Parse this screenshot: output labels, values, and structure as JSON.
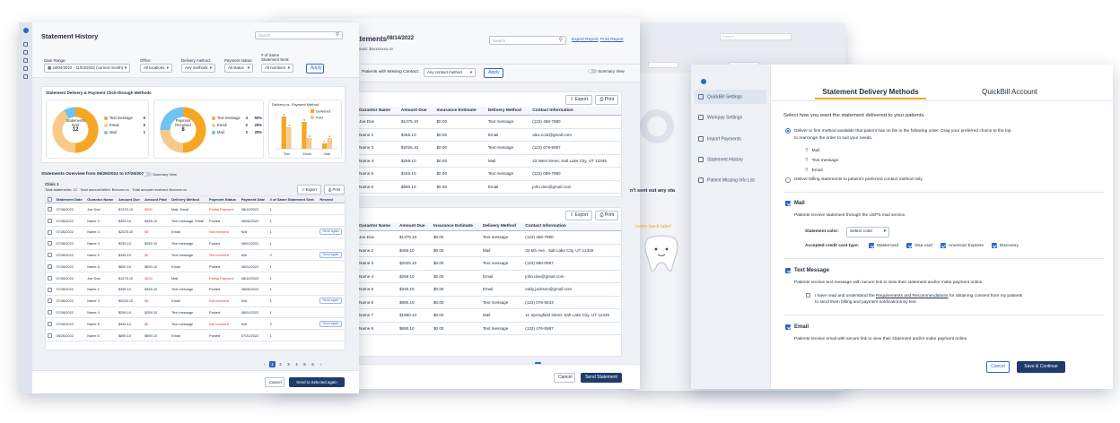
{
  "ghost": {
    "search": "Search",
    "select_a": "",
    "select_b": ""
  },
  "card1": {
    "title": "Statement History",
    "search_placeholder": "Search",
    "filters": {
      "date_range_label": "Date Range:",
      "date_range_value": "10/04/2022 - 11/04/2022 (current month)",
      "office_label": "Office:",
      "office_value": "All locations",
      "delivery_label": "Delivery method:",
      "delivery_value": "Any methods",
      "status_label": "Payment status:",
      "status_value": "All status",
      "sent_label_1": "# of Same",
      "sent_label_2": "Statement Sent:",
      "sent_value": "All numbers",
      "apply": "Apply"
    },
    "chart_section_title": "Statement Delivery & Payment Click-through Methods",
    "donut1": {
      "center_top": "Statements",
      "center_mid": "Sent",
      "center_num": "12",
      "legend": [
        {
          "label": "Text message",
          "value": "6",
          "color": "#f5a623"
        },
        {
          "label": "Email",
          "value": "5",
          "color": "#f8c98a"
        },
        {
          "label": "Mail",
          "value": "1",
          "color": "#6fc3f0"
        }
      ]
    },
    "donut2": {
      "center_top": "Payment",
      "center_mid": "Received",
      "center_num": "8",
      "legend": [
        {
          "label": "Text message",
          "value": "4",
          "pct": "50%",
          "color": "#f5a623"
        },
        {
          "label": "Email",
          "value": "2",
          "pct": "25%",
          "color": "#f8c98a"
        },
        {
          "label": "Mail",
          "value": "2",
          "pct": "25%",
          "color": "#6fc3f0"
        }
      ]
    },
    "chart_data": {
      "type": "bar",
      "title": "Delivery vs. Payment Method",
      "categories": [
        "Text",
        "Email",
        "Mail"
      ],
      "series": [
        {
          "name": "Delivered",
          "values": [
            6,
            5,
            1
          ],
          "color": "#f5a623"
        },
        {
          "name": "Paid",
          "values": [
            4,
            2,
            2
          ],
          "color": "#f8c98a"
        }
      ],
      "ylim": [
        0,
        7
      ]
    },
    "overview_title": "Statements Overview from 06/26/2022 to 07/26/2022",
    "summary_view": "Summary View",
    "clinic": "Clinic 1",
    "totals": {
      "statements": "Total statements: 12",
      "billed": "Total amount billed: $xxxxxx.xx",
      "received": "Total amount received: $xxxxxx.xx"
    },
    "export": "Export",
    "print": "Print",
    "headers": [
      "Statement Date",
      "Gurantor Name",
      "Amount Due",
      "Amount Paid",
      "Delivery Method",
      "Payment Status",
      "Payment Date",
      "# of Same Statement Sent",
      "Resend"
    ],
    "rows": [
      [
        "07/26/2022",
        "Joe Doe",
        "$1375.10",
        "$200",
        "Mail, Email",
        "Partial Payment",
        "08/10/2022",
        "1",
        ""
      ],
      [
        "07/26/2022",
        "Name 2",
        "$455.10",
        "$455.10",
        "Text message, Email",
        "Posted",
        "08/06/2022",
        "1",
        ""
      ],
      [
        "07/26/2022",
        "Name 3",
        "$2025.10",
        "$0",
        "Email",
        "Not received",
        "N/A",
        "1",
        "Send again"
      ],
      [
        "07/26/2022",
        "Name 4",
        "$259.10",
        "$259.10",
        "Text message",
        "Posted",
        "08/01/2022",
        "1",
        ""
      ],
      [
        "07/26/2022",
        "Name 5",
        "$345.10",
        "$0",
        "Text message",
        "Not received",
        "N/A",
        "2",
        "Send again"
      ],
      [
        "07/26/2022",
        "Name 6",
        "$890.10",
        "$890.10",
        "Email",
        "Posted",
        "08/01/2022",
        "1",
        ""
      ],
      [
        "07/26/2022",
        "Joe Doe",
        "$1375.10",
        "$200",
        "Mail",
        "Partial Payment",
        "08/10/2022",
        "1",
        ""
      ],
      [
        "07/26/2022",
        "Name 2",
        "$455.10",
        "$455.10",
        "Text message",
        "Posted",
        "08/06/2022",
        "1",
        ""
      ],
      [
        "07/26/2022",
        "Name 3",
        "$2025.10",
        "$0",
        "Email",
        "Not received",
        "N/A",
        "1",
        "Send again"
      ],
      [
        "07/26/2022",
        "Name 4",
        "$259.10",
        "$259.10",
        "Text message",
        "Posted",
        "08/01/2022",
        "1",
        ""
      ],
      [
        "07/26/2022",
        "Name 5",
        "$345.10",
        "$0",
        "Text message",
        "Not received",
        "N/A",
        "2",
        "Send again"
      ],
      [
        "06/26/2022",
        "Name 6",
        "$890.10",
        "$890.10",
        "Email",
        "Posted",
        "07/21/2022",
        "1",
        ""
      ]
    ],
    "pages": [
      "1",
      "2",
      "3",
      "4",
      "5",
      "6"
    ],
    "cancel": "Cancel",
    "send_selected": "Send to Selected again"
  },
  "card2": {
    "title": "atements",
    "date": "08/14/2022",
    "subtitle": "mount: $xxxxxxxx.xx",
    "search_placeholder": "Search",
    "export_report": "Export Report",
    "print_report": "Print Report",
    "missing_label": "Patients with Missing Contact:",
    "missing_value": "Any contact method",
    "apply": "Apply",
    "summary_view": "Summary View",
    "export": "Export",
    "print": "Print",
    "headers": [
      "Gurantor Name",
      "Amount Due",
      "Insurance Estimate",
      "Delivery Method",
      "Contact Information"
    ],
    "table1": [
      [
        "Joe Doe",
        "$1375.10",
        "$0.00",
        "Text message",
        "(123) 456-7890"
      ],
      [
        "Name 2",
        "$455.10",
        "$0.00",
        "Email",
        "alex.cool@gmail.com"
      ],
      [
        "Name 3",
        "$2025.10",
        "$0.00",
        "Text message",
        "(123) 678-9087"
      ],
      [
        "Name 4",
        "$259.10",
        "$0.00",
        "Mail",
        "23 West street, Salt Lake City, UT 12345"
      ],
      [
        "Name 5",
        "$345.10",
        "$0.00",
        "Text message",
        "(123) 098-7890"
      ],
      [
        "Name 6",
        "$890.10",
        "$0.00",
        "Email",
        "john.doe@gmail.com"
      ]
    ],
    "table2": [
      [
        "Joe Doe",
        "$1375.10",
        "$0.00",
        "Text message",
        "(123) 456-7890"
      ],
      [
        "Name 2",
        "$455.10",
        "$0.00",
        "Mail",
        "33 5th Ave., Salt Lake City, UT 12345"
      ],
      [
        "Name 3",
        "$2025.10",
        "$0.00",
        "Text message",
        "(123) 890-0987"
      ],
      [
        "Name 4",
        "$259.10",
        "$0.00",
        "Email",
        "john.doe@gmail.com"
      ],
      [
        "Name 5",
        "$345.10",
        "$0.00",
        "Email",
        "eddy.jackson@gmail.com"
      ],
      [
        "Name 6",
        "$890.10",
        "$0.00",
        "Text message",
        "(123) 076-5643"
      ],
      [
        "Name 7",
        "$1890.10",
        "$0.00",
        "Mail",
        "11 Springfield street, Salt Lake City, UT 12345"
      ],
      [
        "Name 8",
        "$690.10",
        "$0.00",
        "Text message",
        "(123) 476-5987"
      ]
    ],
    "pages": [
      "1",
      "2",
      "3",
      "4",
      "5",
      "6"
    ],
    "cancel": "Cancel",
    "send": "Send Statement"
  },
  "card3": {
    "text1": "n't sent out any sta",
    "text2": "come back later!"
  },
  "card4": {
    "sidebar": [
      "QuickBill Settings",
      "Workpay Settings",
      "Import Payments",
      "Statement History",
      "Patient Missing Info List"
    ],
    "tab_active": "Statement Delivery Methods",
    "tab_other": "QuickBill Account",
    "intro": "Select how you want the statement delivered to your patients.",
    "opt1_line1": "Deliver to first method available that patient has on file in the following order. Drag your preferred choice to the top",
    "opt1_line2": "to rearrange the order to suit your needs.",
    "order": [
      "Mail",
      "Text message",
      "Email"
    ],
    "opt2": "Deliver billing statements to patient's preferred contact method only.",
    "mail_title": "Mail",
    "mail_desc": "Patients receive statement through the USPS mail service.",
    "color_label": "Statement color:",
    "color_value": "Select color",
    "cards_label": "Accepted credit card type:",
    "cards": [
      "Mastercard",
      "Visa card",
      "American Express",
      "Discovery"
    ],
    "text_title": "Text Message",
    "text_desc": "Patients receive text message with secure link to view their statement and/or make payment online.",
    "consent_pre": "I have read and understand the ",
    "consent_link": "Requirements and Recommendations",
    "consent_post": " for obtaining consent from my patients",
    "consent_line2": "to send them billing and payment notifications by text.",
    "email_title": "Email",
    "email_desc": "Patients receive email with secure link to view their statement and/or make payment online.",
    "cancel": "Cancel",
    "save": "Save & Continue"
  }
}
